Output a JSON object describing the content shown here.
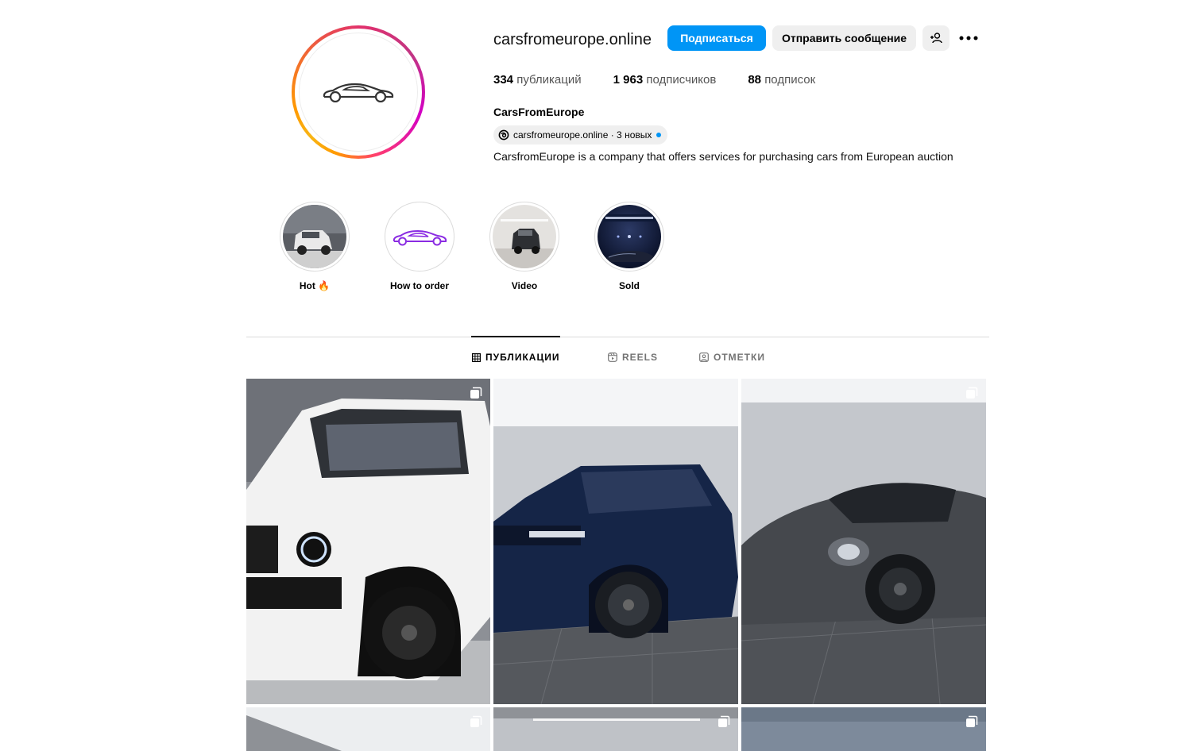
{
  "profile": {
    "username": "carsfromeurope.online",
    "full_name": "CarsFromEurope",
    "bio": "CarsfromEurope is a company that offers services for purchasing cars from European auction",
    "threads_link": "carsfromeurope.online · 3 новых",
    "avatar_icon": "car-logo-icon"
  },
  "actions": {
    "follow_label": "Подписаться",
    "message_label": "Отправить сообщение",
    "suggest_icon": "add-person-icon",
    "more_icon": "more-horizontal-icon"
  },
  "stats": {
    "posts_count": "334",
    "posts_label": "публикаций",
    "followers_count": "1 963",
    "followers_label": "подписчиков",
    "following_count": "88",
    "following_label": "подписок"
  },
  "highlights": [
    {
      "label": "Hot 🔥"
    },
    {
      "label": "How to order"
    },
    {
      "label": "Video"
    },
    {
      "label": "Sold"
    }
  ],
  "tabs": [
    {
      "label": "ПУБЛИКАЦИИ",
      "icon": "grid-icon",
      "active": true
    },
    {
      "label": "REELS",
      "icon": "reels-icon",
      "active": false
    },
    {
      "label": "ОТМЕТКИ",
      "icon": "tagged-icon",
      "active": false
    }
  ],
  "colors": {
    "accent": "#0095f6",
    "button_secondary": "#efefef",
    "highlight_purple": "#8a2be2"
  }
}
